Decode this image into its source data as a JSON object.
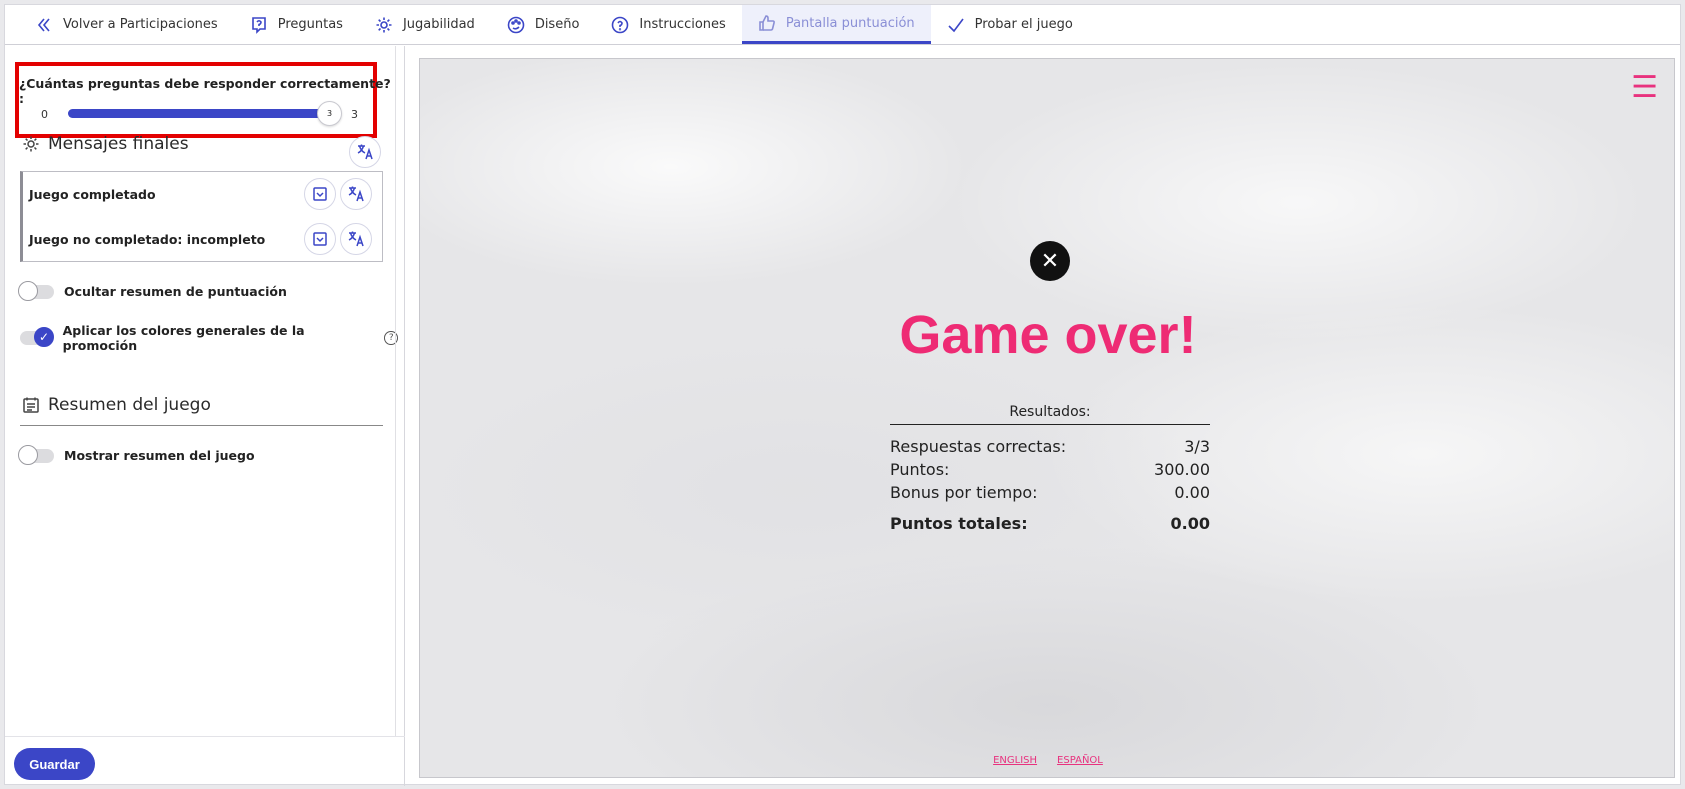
{
  "nav": {
    "items": [
      {
        "label": "Volver a Participaciones",
        "icon": "chevron-left-icon"
      },
      {
        "label": "Preguntas",
        "icon": "question-bubble-icon"
      },
      {
        "label": "Jugabilidad",
        "icon": "gear-icon"
      },
      {
        "label": "Diseño",
        "icon": "palette-icon"
      },
      {
        "label": "Instrucciones",
        "icon": "help-circle-icon"
      },
      {
        "label": "Pantalla puntuación",
        "icon": "thumbs-up-icon",
        "active": true
      },
      {
        "label": "Probar el juego",
        "icon": "check-icon"
      }
    ]
  },
  "left": {
    "question_label": "¿Cuántas preguntas debe responder correctamente? :",
    "slider": {
      "min": "0",
      "max": "3",
      "value": "3",
      "fill_fraction": 1.0
    },
    "final_messages": {
      "title": "Mensajes finales",
      "rows": [
        {
          "label": "Juego completado"
        },
        {
          "label": "Juego no completado: incompleto"
        }
      ]
    },
    "toggles": {
      "hide_summary": {
        "label": "Ocultar resumen de puntuación",
        "on": false
      },
      "apply_colors": {
        "label": "Aplicar los colores generales de la promoción",
        "on": true,
        "help": "?"
      }
    },
    "game_summary": {
      "title": "Resumen del juego",
      "show_summary": {
        "label": "Mostrar resumen del juego",
        "on": false
      }
    },
    "save_label": "Guardar"
  },
  "preview": {
    "menu_icon": "☰",
    "close_icon": "✕",
    "title": "Game over!",
    "results_header": "Resultados:",
    "rows": [
      {
        "label": "Respuestas correctas:",
        "value": "3/3"
      },
      {
        "label": "Puntos:",
        "value": "300.00"
      },
      {
        "label": "Bonus por tiempo:",
        "value": "0.00"
      }
    ],
    "total": {
      "label": "Puntos totales:",
      "value": "0.00"
    },
    "languages": [
      "ENGLISH",
      "ESPAÑOL"
    ]
  },
  "colors": {
    "accent": "#3b46c7",
    "brand_pink": "#ee2b74",
    "highlight_red": "#e30000"
  }
}
